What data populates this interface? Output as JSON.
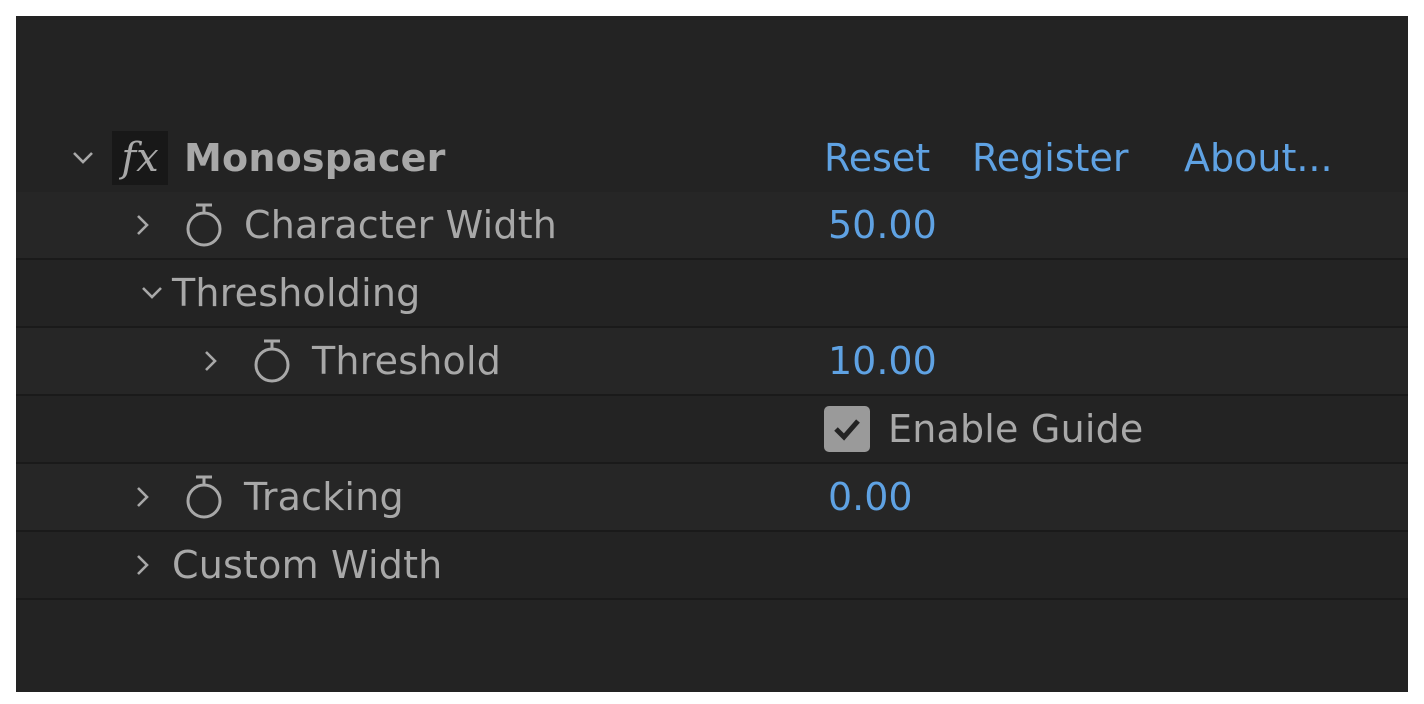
{
  "effect": {
    "fx_label": "fx",
    "name": "Monospacer",
    "actions": {
      "reset": "Reset",
      "register": "Register",
      "about": "About..."
    }
  },
  "properties": {
    "character_width": {
      "label": "Character Width",
      "value": "50.00"
    },
    "thresholding": {
      "label": "Thresholding"
    },
    "threshold": {
      "label": "Threshold",
      "value": "10.00"
    },
    "enable_guide": {
      "label": "Enable Guide",
      "checked": true
    },
    "tracking": {
      "label": "Tracking",
      "value": "0.00"
    },
    "custom_width": {
      "label": "Custom Width"
    }
  },
  "colors": {
    "panel_bg": "#232323",
    "text": "#a8a8a8",
    "accent_value": "#5fa2e3"
  }
}
